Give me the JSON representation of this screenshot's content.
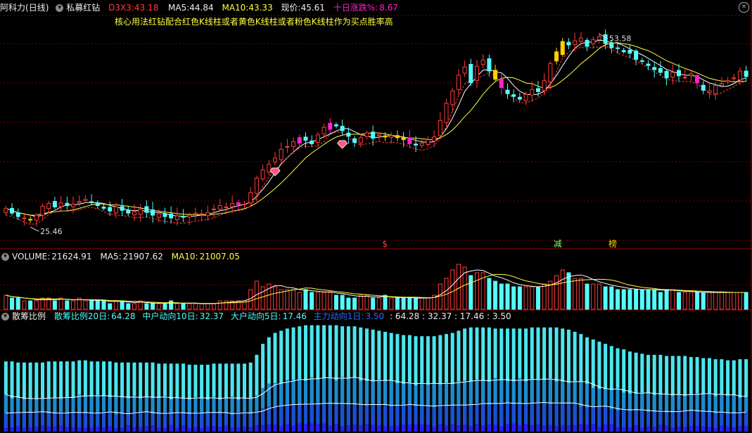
{
  "main": {
    "stock_name": "阿科力",
    "period": "(日线)",
    "indicator": "私募红钻",
    "d3x3_label": "D3X3:",
    "d3x3_value": "43.18",
    "ma5_label": "MA5:",
    "ma5_value": "44.84",
    "ma10_label": "MA10:",
    "ma10_value": "43.33",
    "price_label": "现价:",
    "price_value": "45.61",
    "change_label": "十日涨跌%:",
    "change_value": "8.67",
    "note": "核心用法红钻配合红色K线柱或者黄色K线柱或者粉色K线柱作为买点胜率高",
    "high_label": "53.58",
    "low_label": "25.46",
    "markers": [
      "$",
      "减",
      "榜"
    ],
    "close_icon": "close-x-icon"
  },
  "volume": {
    "label": "VOLUME:",
    "value": "21624.91",
    "ma5_label": "MA5:",
    "ma5_value": "21907.62",
    "ma10_label": "MA10:",
    "ma10_value": "21007.05"
  },
  "chips": {
    "label": "散筹比例",
    "r20_label": "散筹比例20日:",
    "r20_value": "64.28",
    "mid_label": "中户动向10日:",
    "mid_value": "32.37",
    "big_label": "大户动向5日:",
    "big_value": "17.46",
    "main_label": "主力动向1日:",
    "main_value": "3.50",
    "summary": ": 64.28 : 32.37 : 17.46 : 3.50"
  },
  "colors": {
    "up": "#ff3b3b",
    "down": "#54fcfc",
    "yellow": "#ffd200",
    "pink": "#ff22c8",
    "grid": "#7a0000",
    "ma5": "#ffffff",
    "ma10": "#ffff40"
  },
  "chart_data": [
    {
      "type": "candlestick",
      "title": "私募红钻",
      "n": 122,
      "close": [
        28.2,
        27.5,
        27.0,
        26.8,
        26.5,
        27.2,
        28.5,
        28.9,
        28.4,
        29.0,
        28.6,
        28.8,
        29.2,
        29.5,
        29.0,
        28.6,
        28.2,
        27.8,
        28.4,
        27.9,
        27.5,
        27.7,
        28.1,
        27.6,
        27.2,
        27.4,
        27.0,
        26.8,
        27.1,
        26.9,
        27.2,
        27.5,
        27.4,
        27.6,
        28.1,
        28.6,
        28.4,
        28.9,
        29.0,
        28.8,
        30.5,
        32.6,
        33.8,
        34.6,
        35.5,
        36.8,
        37.2,
        37.9,
        38.5,
        38.1,
        37.6,
        38.9,
        40.0,
        40.6,
        40.2,
        39.5,
        38.7,
        37.8,
        38.5,
        39.2,
        38.4,
        38.9,
        38.6,
        38.8,
        38.5,
        38.2,
        37.6,
        37.4,
        37.7,
        38.2,
        38.6,
        41.0,
        43.5,
        45.3,
        47.6,
        48.8,
        46.5,
        48.9,
        49.8,
        48.2,
        47.0,
        45.8,
        44.9,
        44.5,
        44.1,
        44.8,
        45.5,
        45.2,
        46.8,
        49.3,
        51.0,
        52.5,
        52.0,
        52.6,
        53.0,
        51.8,
        52.8,
        53.2,
        52.2,
        51.6,
        51.5,
        51.0,
        50.8,
        49.9,
        49.6,
        49.0,
        48.4,
        48.0,
        47.2,
        48.0,
        47.5,
        47.3,
        47.8,
        46.5,
        45.4,
        45.3,
        46.1,
        46.4,
        46.8,
        47.2,
        48.2,
        47.4
      ],
      "prices_visible": {
        "high": 53.58,
        "low": 25.46,
        "current": 45.61
      },
      "markers": [
        {
          "index": 44,
          "shape": "gem"
        },
        {
          "index": 55,
          "shape": "gem"
        },
        {
          "index": 62,
          "text": "$"
        },
        {
          "index": 90,
          "text": "减"
        },
        {
          "index": 99,
          "text": "榜"
        }
      ],
      "series": [
        {
          "name": "MA5",
          "value": 44.84
        },
        {
          "name": "MA10",
          "value": 43.33
        },
        {
          "name": "D3X3",
          "value": 43.18
        }
      ]
    },
    {
      "type": "bar",
      "title": "VOLUME",
      "values": [
        5,
        4,
        4,
        3,
        3,
        3,
        4,
        4,
        3,
        4,
        3,
        3,
        4,
        3,
        3,
        3,
        3,
        2,
        3,
        3,
        2,
        2,
        3,
        2,
        2,
        2,
        2,
        3,
        2,
        2,
        2,
        2,
        2,
        2,
        2,
        3,
        3,
        3,
        3,
        3,
        7,
        10,
        8,
        9,
        8,
        7,
        7,
        7,
        6,
        7,
        6,
        6,
        6,
        6,
        5,
        5,
        4,
        4,
        5,
        5,
        4,
        4,
        5,
        4,
        4,
        4,
        4,
        4,
        4,
        4,
        5,
        9,
        11,
        14,
        16,
        15,
        12,
        13,
        13,
        11,
        10,
        9,
        9,
        8,
        8,
        8,
        8,
        8,
        9,
        10,
        12,
        14,
        13,
        11,
        11,
        9,
        9,
        9,
        8,
        8,
        7,
        7,
        7,
        7,
        7,
        7,
        7,
        6,
        7,
        7,
        6,
        6,
        6,
        6,
        6,
        6,
        6,
        6,
        6,
        6,
        6,
        6
      ],
      "series": [
        {
          "name": "VOLUME",
          "value": 21624.91
        },
        {
          "name": "MA5",
          "value": 21907.62
        },
        {
          "name": "MA10",
          "value": 21007.05
        }
      ]
    },
    {
      "type": "bar",
      "title": "散筹比例",
      "values": [
        64,
        64,
        63,
        63,
        63,
        63,
        63,
        64,
        64,
        64,
        64,
        64,
        65,
        65,
        64,
        64,
        64,
        64,
        63,
        63,
        63,
        63,
        63,
        63,
        63,
        62,
        62,
        62,
        62,
        62,
        61,
        61,
        61,
        61,
        62,
        62,
        62,
        62,
        62,
        62,
        63,
        70,
        80,
        86,
        90,
        92,
        94,
        95,
        96,
        97,
        97,
        97,
        97,
        97,
        97,
        96,
        96,
        96,
        95,
        94,
        93,
        92,
        91,
        90,
        89,
        88,
        88,
        87,
        87,
        87,
        87,
        88,
        89,
        90,
        92,
        94,
        95,
        95,
        95,
        95,
        94,
        94,
        94,
        94,
        94,
        94,
        95,
        95,
        95,
        95,
        95,
        94,
        93,
        91,
        89,
        86,
        84,
        82,
        80,
        78,
        76,
        75,
        73,
        72,
        71,
        70,
        70,
        70,
        69,
        69,
        69,
        69,
        68,
        68,
        67,
        67,
        66,
        66,
        65,
        65,
        66,
        66
      ],
      "series": [
        {
          "name": "散筹比例20日",
          "value": 64.28
        },
        {
          "name": "中户动向10日",
          "value": 32.37
        },
        {
          "name": "大户动向5日",
          "value": 17.46
        },
        {
          "name": "主力动向1日",
          "value": 3.5
        }
      ]
    }
  ]
}
